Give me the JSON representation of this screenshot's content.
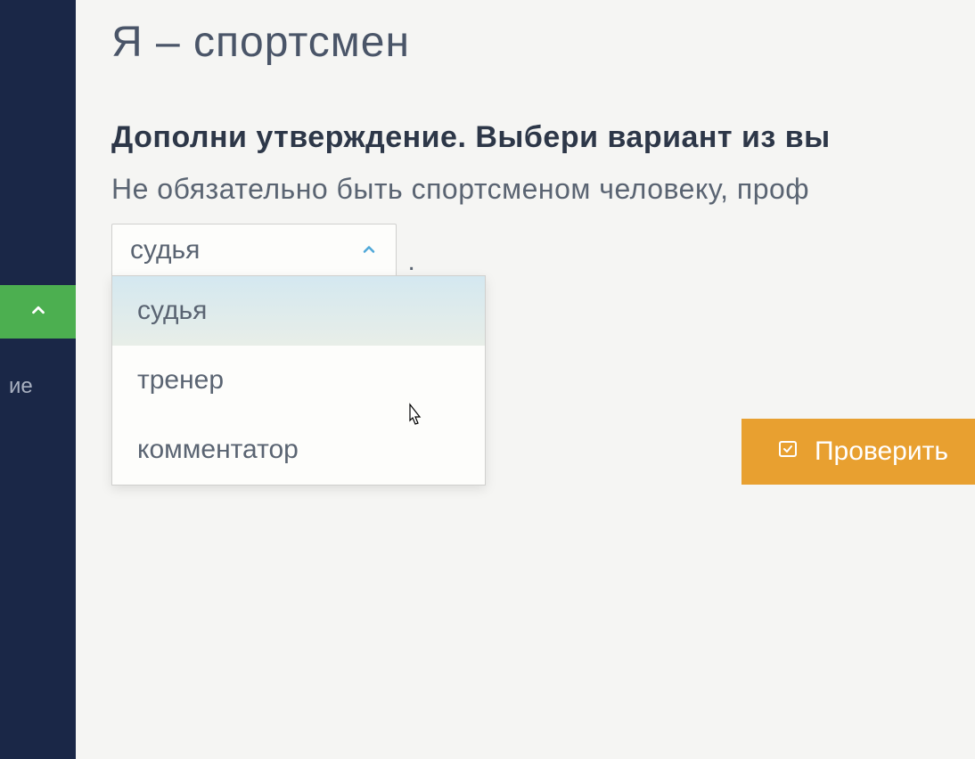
{
  "sidebar": {
    "cut_label": "ие"
  },
  "page": {
    "title": "Я – спортсмен"
  },
  "task": {
    "instruction": "Дополни утверждение. Выбери вариант из вы",
    "sentence": "Не обязательно быть спортсменом человеку, проф"
  },
  "dropdown": {
    "selected": "судья",
    "period": ".",
    "options": [
      "судья",
      "тренер",
      "комментатор"
    ]
  },
  "actions": {
    "check_label": "Проверить"
  }
}
